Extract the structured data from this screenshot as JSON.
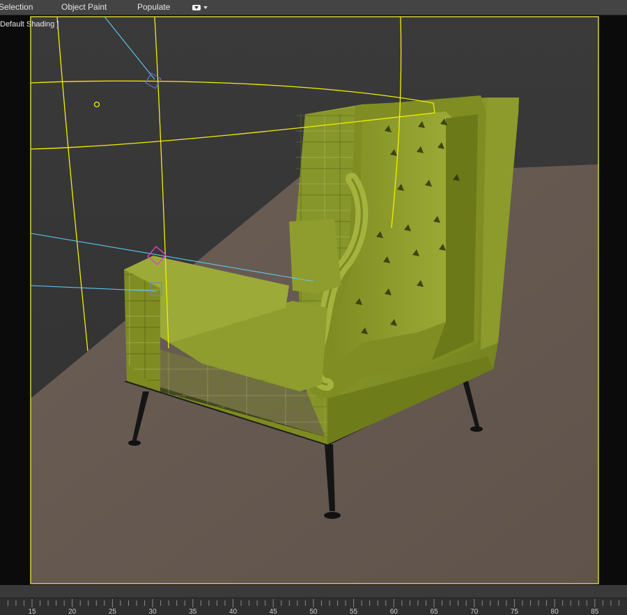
{
  "ribbon": {
    "items": [
      {
        "name": "ribbon-selection",
        "label": "Selection"
      },
      {
        "name": "ribbon-object-paint",
        "label": "Object Paint"
      },
      {
        "name": "ribbon-populate",
        "label": "Populate"
      }
    ]
  },
  "viewport": {
    "shading_label": "Default Shading ]"
  },
  "colors": {
    "viewport_border": "#d8d23a",
    "wall": "#3b3b3b",
    "floor": "#65584f",
    "chair": "#8a9a2a",
    "spline_yellow": "#f4f000",
    "spline_cyan": "#5ec8f0"
  },
  "timeline": {
    "ticks": [
      "15",
      "20",
      "25",
      "30",
      "35",
      "40",
      "45",
      "50",
      "55",
      "60",
      "65",
      "70",
      "75",
      "80",
      "85"
    ]
  }
}
